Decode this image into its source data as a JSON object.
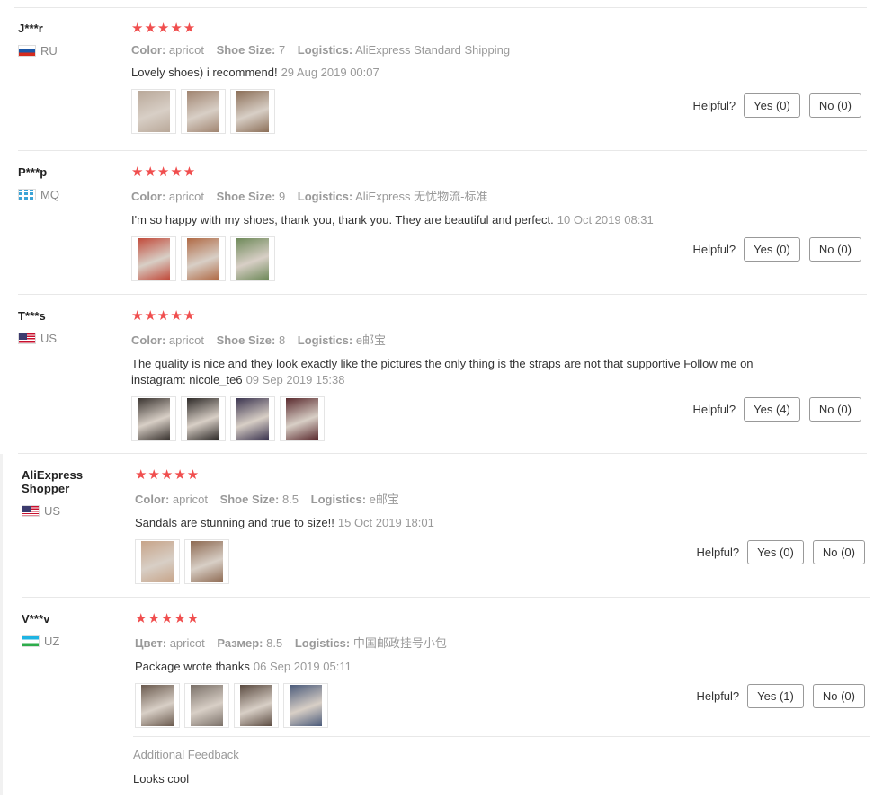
{
  "labels": {
    "color": "Color:",
    "shoe_size": "Shoe Size:",
    "logistics": "Logistics:",
    "helpful": "Helpful?"
  },
  "stars": "★★★★★",
  "reviews": [
    {
      "user": "J***r",
      "country": "RU",
      "flag": "ru",
      "color_label": "Color:",
      "color": "apricot",
      "size_label": "Shoe Size:",
      "size": "7",
      "log_label": "Logistics:",
      "logistics": "AliExpress Standard Shipping",
      "comment": "Lovely shoes) i recommend!",
      "date": "29 Aug 2019 00:07",
      "yes": "Yes (0)",
      "no": "No (0)",
      "photos": [
        "#b9a899",
        "#a08470",
        "#8c6f58"
      ]
    },
    {
      "user": "P***p",
      "country": "MQ",
      "flag": "mq",
      "color_label": "Color:",
      "color": "apricot",
      "size_label": "Shoe Size:",
      "size": "9",
      "log_label": "Logistics:",
      "logistics": "AliExpress 无忧物流-标准",
      "comment": "I'm so happy with my shoes, thank you, thank you. They are beautiful and perfect.",
      "date": "10 Oct 2019 08:31",
      "yes": "Yes (0)",
      "no": "No (0)",
      "photos": [
        "#c14a3a",
        "#b06a45",
        "#6f8a5a"
      ]
    },
    {
      "user": "T***s",
      "country": "US",
      "flag": "us",
      "color_label": "Color:",
      "color": "apricot",
      "size_label": "Shoe Size:",
      "size": "8",
      "log_label": "Logistics:",
      "logistics": "e邮宝",
      "comment": "The quality is nice and they look exactly like the pictures the only thing is the straps are not that supportive Follow me on instagram: nicole_te6",
      "date": "09 Sep 2019 15:38",
      "yes": "Yes (4)",
      "no": "No (0)",
      "photos": [
        "#3a3430",
        "#2e2a28",
        "#3c3550",
        "#5a2a2e"
      ]
    },
    {
      "user": "AliExpress Shopper",
      "country": "US",
      "flag": "us",
      "color_label": "Color:",
      "color": "apricot",
      "size_label": "Shoe Size:",
      "size": "8.5",
      "log_label": "Logistics:",
      "logistics": "e邮宝",
      "comment": "Sandals are stunning and true to size!!",
      "date": "15 Oct 2019 18:01",
      "yes": "Yes (0)",
      "no": "No (0)",
      "photos": [
        "#c7a489",
        "#8e6a52"
      ]
    },
    {
      "user": "V***v",
      "country": "UZ",
      "flag": "uz",
      "color_label": "Цвет:",
      "color": "apricot",
      "size_label": "Размер:",
      "size": "8.5",
      "log_label": "Logistics:",
      "logistics": "中国邮政挂号小包",
      "comment": "Package wrote thanks",
      "date": "06 Sep 2019 05:11",
      "yes": "Yes (1)",
      "no": "No (0)",
      "photos": [
        "#6a5a4e",
        "#7a7068",
        "#5a4a40",
        "#4a5a7a"
      ]
    }
  ],
  "additional": {
    "title": "Additional Feedback",
    "text": "Looks cool"
  }
}
